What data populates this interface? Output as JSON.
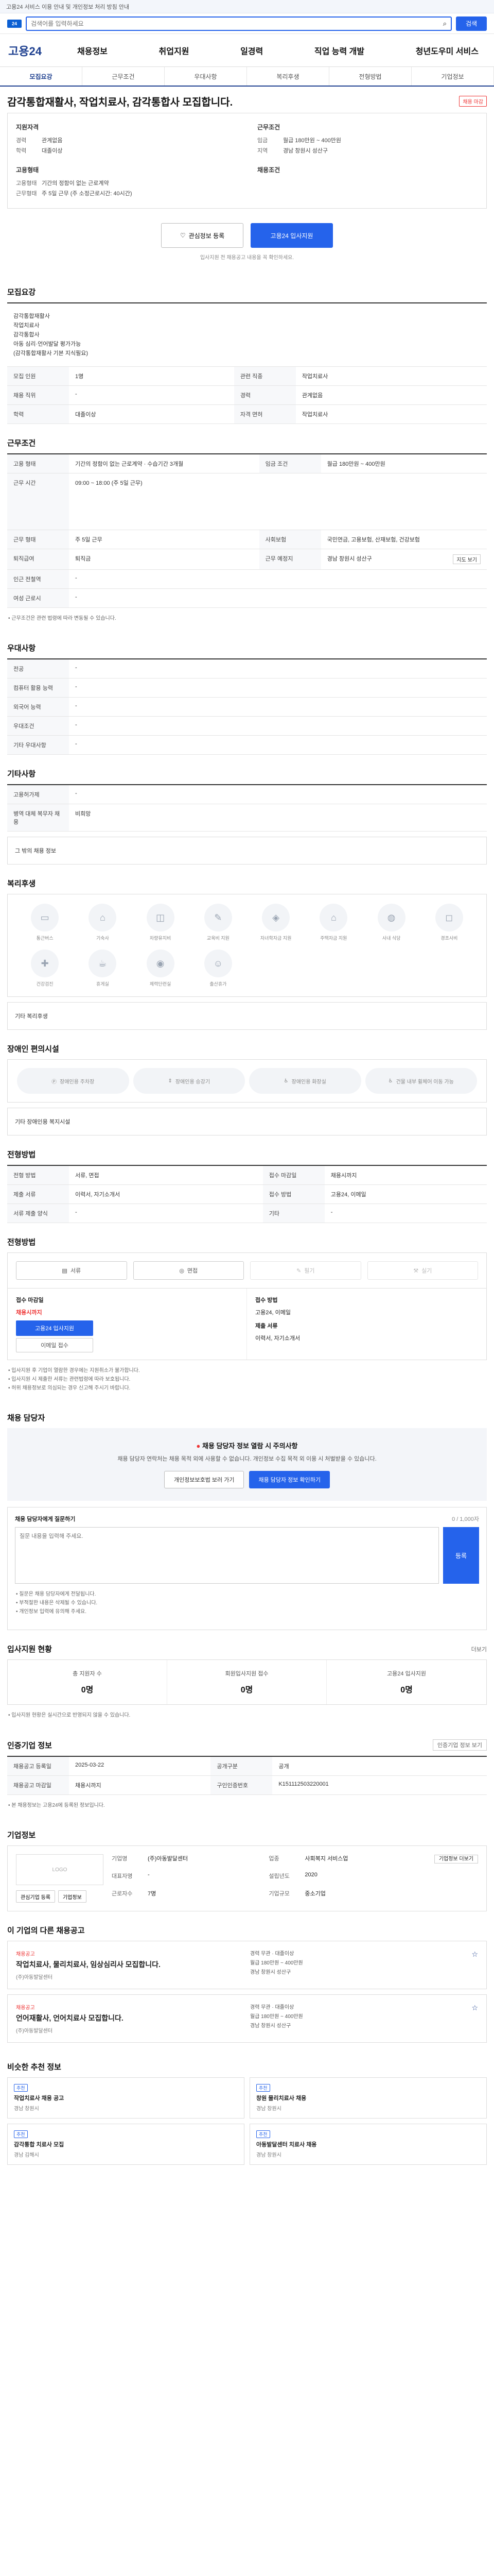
{
  "banner": {
    "text": "고용24 서비스 이용 안내 및 개인정보 처리 방침 안내"
  },
  "search": {
    "placeholder": "검색어를 입력하세요",
    "button": "검색"
  },
  "gnb": {
    "logo": "고용24",
    "menu": [
      "채용정보",
      "취업지원",
      "일경력",
      "직업 능력 개발",
      "청년도우미 서비스"
    ]
  },
  "tabs": [
    "모집요강",
    "근무조건",
    "우대사항",
    "복리후생",
    "전형방법",
    "기업정보"
  ],
  "job": {
    "badge": "채용 마감",
    "title": "감각통합재활사, 작업치료사, 감각통합사 모집합니다.",
    "summary": {
      "g1_title": "지원자격",
      "g1": [
        {
          "k": "경력",
          "v": "관계없음"
        },
        {
          "k": "학력",
          "v": "대졸이상"
        }
      ],
      "g2_title": "근무조건",
      "g2": [
        {
          "k": "임금",
          "v": "월급 180만원 ~ 400만원"
        },
        {
          "k": "지역",
          "v": "경남 창원시 성산구"
        }
      ],
      "g3_title": "고용형태",
      "g3": [
        {
          "k": "고용형태",
          "v": "기간의 정함이 없는 근로계약"
        },
        {
          "k": "근무형태",
          "v": "주 5일 근무 (주 소정근로시간: 40시간)"
        }
      ],
      "g4_title": "채용조건",
      "g4": []
    },
    "scrap_btn": "관심정보 등록",
    "apply_btn": "고용24 입사지원",
    "apply_note": "입사지원 전 채용공고 내용을 꼭 확인하세요."
  },
  "recruit": {
    "title": "모집요강",
    "rows": [
      {
        "k": "모집직종",
        "v": "감각통합재활사\n작업치료사\n감각통합사\n아동 심리·언어발달 평가가능\n(감각통합재활사 기본 지식필요)"
      },
      {
        "k": "모집 인원",
        "v": "1명"
      },
      {
        "k": "관련 직종",
        "v": "작업치료사"
      },
      {
        "k": "채용 직위",
        "v": "-"
      },
      {
        "k": "경력",
        "v": "관계없음"
      },
      {
        "k": "학력",
        "v": "대졸이상"
      },
      {
        "k": "자격 면허",
        "v": "작업치료사"
      }
    ]
  },
  "conditions": {
    "title": "근무조건",
    "rows": [
      {
        "k": "고용 형태",
        "v": "기간의 정함이 없는 근로계약 · 수습기간 3개월"
      },
      {
        "k": "임금 조건",
        "v": "월급 180만원 ~ 400만원"
      },
      {
        "k": "근무 시간",
        "v": "09:00 ~ 18:00 (주 5일 근무)"
      },
      {
        "k": "근무 형태",
        "v": "주 5일 근무"
      },
      {
        "k": "사회보험",
        "v": "국민연금, 고용보험, 산재보험, 건강보험"
      },
      {
        "k": "퇴직급여",
        "v": "퇴직금"
      },
      {
        "k": "근무 예정지",
        "v": "경남 창원시 성산구"
      },
      {
        "k": "인근 전철역",
        "v": "-"
      },
      {
        "k": "여성 근로시",
        "v": "-"
      }
    ],
    "map_link": "지도 보기",
    "footnote": "근무조건은 관련 법령에 따라 변동될 수 있습니다."
  },
  "preference": {
    "title": "우대사항",
    "rows": [
      {
        "k": "전공",
        "v": "-"
      },
      {
        "k": "컴퓨터 활용 능력",
        "v": "-"
      },
      {
        "k": "외국어 능력",
        "v": "-"
      },
      {
        "k": "우대조건",
        "v": "-"
      },
      {
        "k": "기타 우대사항",
        "v": "-"
      }
    ]
  },
  "etc": {
    "title": "기타사항",
    "rows": [
      {
        "k": "고용허가제",
        "v": "-"
      },
      {
        "k": "병역 대체 복무자 채용",
        "v": "비희망"
      }
    ],
    "other_label": "그 밖의 채용 정보"
  },
  "welfare": {
    "title": "복리후생",
    "items": [
      "통근버스",
      "기숙사",
      "차량유지비",
      "교육비 지원",
      "자녀학자금 지원",
      "주택자금 지원",
      "사내 식당",
      "경조사비",
      "건강검진",
      "휴게실",
      "체력단련실",
      "출산휴가"
    ],
    "box_label": "기타 복리후생"
  },
  "disabled": {
    "title": "장애인 편의시설",
    "items": [
      "장애인용 주차장",
      "장애인용 승강기",
      "장애인용 화장실",
      "건물 내부 휠체어 이동 가능"
    ],
    "box_label": "기타 장애인용 복지시설"
  },
  "screening": {
    "title": "전형방법",
    "rows": [
      {
        "k": "전형 방법",
        "v": "서류, 면접"
      },
      {
        "k": "접수 마감일",
        "v": "채용시까지"
      },
      {
        "k": "제출 서류",
        "v": "이력서, 자기소개서"
      },
      {
        "k": "접수 방법",
        "v": "고용24, 이메일"
      },
      {
        "k": "서류 제출 양식",
        "v": "-"
      },
      {
        "k": "기타",
        "v": "-"
      }
    ]
  },
  "apply": {
    "title": "전형방법",
    "methods": [
      "서류",
      "면접",
      "필기",
      "실기"
    ],
    "col1_title": "접수 마감일",
    "col1_value": "채용시까지",
    "col1_btn": "고용24 입사지원",
    "col1_btn2": "이메일 접수",
    "col2_title": "접수 방법",
    "col2_value": "고용24, 이메일",
    "col2_sub_title": "제출 서류",
    "col2_sub": "이력서, 자기소개서",
    "notes": [
      "입사지원 후 기업이 열람한 경우에는 지원취소가 불가합니다.",
      "입사지원 시 제출한 서류는 관련법령에 따라 보호됩니다.",
      "허위 채용정보로 의심되는 경우 신고해 주시기 바랍니다."
    ]
  },
  "inquiry": {
    "title": "채용 담당자",
    "warn_title": "채용 담당자 정보 열람 시 주의사항",
    "warn_text": "채용 담당자 연락처는 채용 목적 외에 사용할 수 없습니다. 개인정보 수집 목적 외 이용 시 처벌받을 수 있습니다.",
    "btn1": "개인정보보호법 보러 가기",
    "btn2": "채용 담당자 정보 확인하기",
    "qa_title": "채용 담당자에게 질문하기",
    "qa_counter": "0 / 1,000자",
    "qa_placeholder": "질문 내용을 입력해 주세요.",
    "qa_btn": "등록",
    "qa_notes": [
      "질문은 채용 담당자에게 전달됩니다.",
      "부적절한 내용은 삭제될 수 있습니다.",
      "개인정보 입력에 유의해 주세요."
    ]
  },
  "stats": {
    "title": "입사지원 현황",
    "more": "더보기",
    "items": [
      {
        "label": "총 지원자 수",
        "value": "0명"
      },
      {
        "label": "회원입사지원 접수",
        "value": "0명"
      },
      {
        "label": "고용24 입사지원",
        "value": "0명"
      }
    ],
    "note": "입사지원 현황은 실시간으로 반영되지 않을 수 있습니다."
  },
  "info": {
    "title": "인증기업 정보",
    "link": "인증기업 정보 보기",
    "rows": [
      {
        "k": "채용공고 등록일",
        "v": "2025-03-22",
        "k2": "공개구분",
        "v2": "공개"
      },
      {
        "k": "채용공고 마감일",
        "v": "채용시까지",
        "k2": "구인인증번호",
        "v2": "K151112503220001"
      }
    ],
    "note": "본 채용정보는 고용24에 등록된 정보입니다."
  },
  "company": {
    "title": "기업정보",
    "logo_alt": "LOGO",
    "link": "기업정보 더보기",
    "rows": [
      {
        "k": "기업명",
        "v": "(주)아동발달센터",
        "k2": "업종",
        "v2": "사회복지 서비스업"
      },
      {
        "k": "대표자명",
        "v": "-",
        "k2": "설립년도",
        "v2": "2020"
      },
      {
        "k": "근로자수",
        "v": "7명",
        "k2": "기업규모",
        "v2": "중소기업"
      }
    ],
    "btn1": "관심기업 등록",
    "btn2": "기업정보"
  },
  "recommend": {
    "title": "이 기업의 다른 채용공고",
    "cards": [
      {
        "tag": "채용공고",
        "title": "작업치료사, 물리치료사, 임상심리사 모집합니다.",
        "company": "(주)아동발달센터",
        "meta1": "경력 무관 · 대졸이상",
        "meta2": "월급 180만원 ~ 400만원",
        "meta3": "경남 창원시 성산구"
      },
      {
        "tag": "채용공고",
        "title": "언어재활사, 언어치료사 모집합니다.",
        "company": "(주)아동발달센터",
        "meta1": "경력 무관 · 대졸이상",
        "meta2": "월급 180만원 ~ 400만원",
        "meta3": "경남 창원시 성산구"
      }
    ]
  },
  "similar": {
    "title": "비슷한 추천 정보",
    "cards": [
      {
        "tag": "추천",
        "title": "작업치료사 채용 공고",
        "meta": "경남 창원시"
      },
      {
        "tag": "추천",
        "title": "창원 물리치료사 채용",
        "meta": "경남 창원시"
      },
      {
        "tag": "추천",
        "title": "감각통합 치료사 모집",
        "meta": "경남 김해시"
      },
      {
        "tag": "추천",
        "title": "아동발달센터 치료사 채용",
        "meta": "경남 창원시"
      }
    ]
  }
}
